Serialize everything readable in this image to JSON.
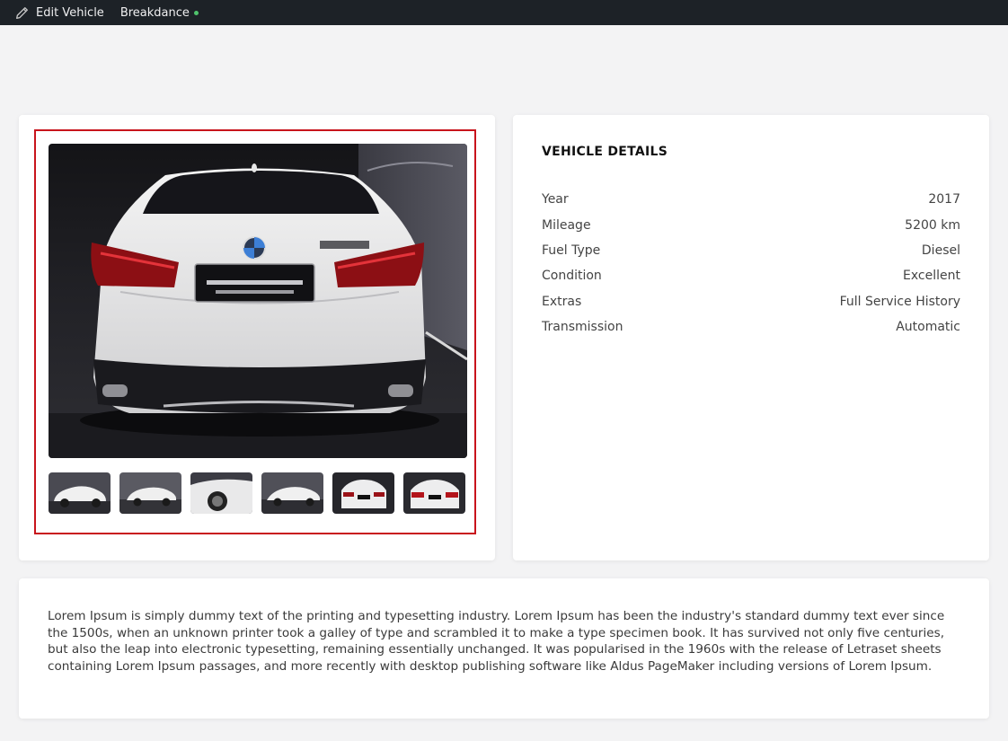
{
  "adminbar": {
    "edit_label": "Edit Vehicle",
    "edit_icon": "pencil-icon",
    "builder_label": "Breakdance",
    "builder_status_color": "#4fc36c"
  },
  "gallery": {
    "main_image_alt": "",
    "thumb_count": 6,
    "highlight_color": "#c8141c"
  },
  "details": {
    "title": "VEHICLE DETAILS",
    "rows": [
      {
        "label": "Year",
        "value": "2017"
      },
      {
        "label": "Mileage",
        "value": "5200 km"
      },
      {
        "label": "Fuel Type",
        "value": "Diesel"
      },
      {
        "label": "Condition",
        "value": "Excellent"
      },
      {
        "label": "Extras",
        "value": "Full Service History"
      },
      {
        "label": "Transmission",
        "value": "Automatic"
      }
    ]
  },
  "description": {
    "text": "Lorem Ipsum is simply dummy text of the printing and typesetting industry. Lorem Ipsum has been the industry's standard dummy text ever since the 1500s, when an unknown printer took a galley of type and scrambled it to make a type specimen book. It has survived not only five centuries, but also the leap into electronic typesetting, remaining essentially unchanged. It was popularised in the 1960s with the release of Letraset sheets containing Lorem Ipsum passages, and more recently with desktop publishing software like Aldus PageMaker including versions of Lorem Ipsum."
  }
}
